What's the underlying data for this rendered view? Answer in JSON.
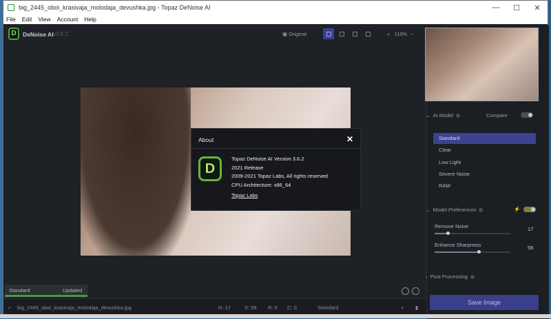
{
  "window": {
    "title": "big_2445_oboi_krasivaja_molodaja_devushka.jpg - Topaz DeNoise AI",
    "minimize": "—",
    "maximize": "☐",
    "close": "✕"
  },
  "menu": [
    "File",
    "Edit",
    "View",
    "Account",
    "Help"
  ],
  "brand": {
    "name": "DeNoise AI",
    "version": "v3.6.2",
    "logo_letter": "D"
  },
  "toolbar": {
    "original_label": "Original",
    "zoom": "110%",
    "zoom_minus": "−"
  },
  "about": {
    "title": "About",
    "close": "✕",
    "lines": [
      "Topaz DeNoise AI Version 3.6.2",
      "2021 Release",
      "2009-2021 Topaz Labs, All rights reserved",
      "CPU Architecture: x86_64"
    ],
    "link": "Topaz Labs",
    "logo_letter": "D"
  },
  "panel": {
    "ai_model": "AI Model",
    "compare": "Compare",
    "models": [
      "Standard",
      "Clear",
      "Low Light",
      "Severe Noise",
      "RAW"
    ],
    "selected_model": "Standard",
    "model_prefs": "Model Preferences",
    "remove_noise_label": "Remove Noise",
    "remove_noise_value": "17",
    "remove_noise_level": 0.17,
    "sharpen_label": "Enhance Sharpness",
    "sharpen_value": "58",
    "sharpen_level": 0.58,
    "post_processing": "Post Processing",
    "save": "Save Image"
  },
  "status_badge": {
    "model": "Standard",
    "state": "Updated"
  },
  "statusbar": {
    "filename": "big_2445_oboi_krasivaja_molodaja_devushka.jpg",
    "n": "N: 17",
    "s": "S: 58",
    "r": "R: 0",
    "c": "C: 0",
    "model": "Standard",
    "check": "✓"
  },
  "colors": {
    "accent": "#3d4290",
    "logo_green": "#6bb43f",
    "status_green": "#4a9a3a"
  }
}
